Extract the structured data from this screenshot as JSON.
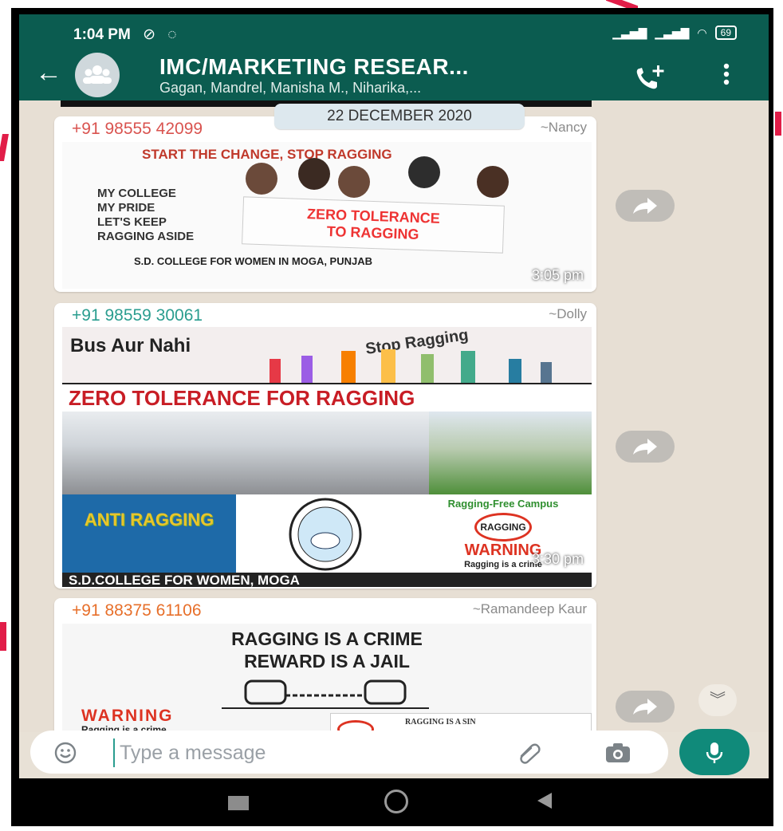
{
  "status_bar": {
    "time": "1:04 PM",
    "battery": "69"
  },
  "header": {
    "group_name": "IMC/MARKETING RESEAR...",
    "members": "Gagan, Mandrel, Manisha M., Niharika,..."
  },
  "chat": {
    "date_divider": "22 DECEMBER 2020",
    "messages": [
      {
        "sender": "+91 98555 42099",
        "sender_color": "#d9534f",
        "nickname": "~Nancy",
        "time": "3:05 pm",
        "poster": {
          "headline": "START THE CHANGE, STOP RAGGING",
          "left_lines": [
            "MY COLLEGE",
            "MY PRIDE",
            "LET'S KEEP",
            "RAGGING ASIDE"
          ],
          "sign_line1": "ZERO TOLERANCE",
          "sign_line2": "TO RAGGING",
          "footer": "S.D. COLLEGE FOR WOMEN IN MOGA, PUNJAB"
        }
      },
      {
        "sender": "+91 98559 30061",
        "sender_color": "#2a9d8f",
        "nickname": "~Dolly",
        "time": "3:30 pm",
        "poster": {
          "top_line": "Bus Aur Nahi",
          "top_right": "Stop Ragging",
          "headline": "ZERO TOLERANCE FOR RAGGING",
          "anti": "ANTI RAGGING",
          "campus": "Ragging-Free Campus",
          "badge": "RAGGING",
          "warning": "WARNING",
          "warning_sub": "Ragging is a crime",
          "footer": "S.D.COLLEGE FOR WOMEN, MOGA"
        }
      },
      {
        "sender": "+91 88375 61106",
        "sender_color": "#e76f2a",
        "nickname": "~Ramandeep Kaur",
        "poster": {
          "line1": "RAGGING IS A CRIME",
          "line2": "REWARD IS A JAIL",
          "warning": "WARNING",
          "warning_sub": "Ragging is a crime",
          "sin": "RAGGING IS A SIN"
        }
      }
    ]
  },
  "composer": {
    "placeholder": "Type a message"
  },
  "colors": {
    "header": "#0b5c50",
    "accent": "#108a7a",
    "chat_bg": "#e7dfd4"
  },
  "icons": [
    "back-arrow-icon",
    "group-avatar-icon",
    "add-call-icon",
    "more-vert-icon",
    "forward-icon",
    "scroll-down-icon",
    "emoji-icon",
    "attach-icon",
    "camera-icon",
    "mic-icon"
  ]
}
